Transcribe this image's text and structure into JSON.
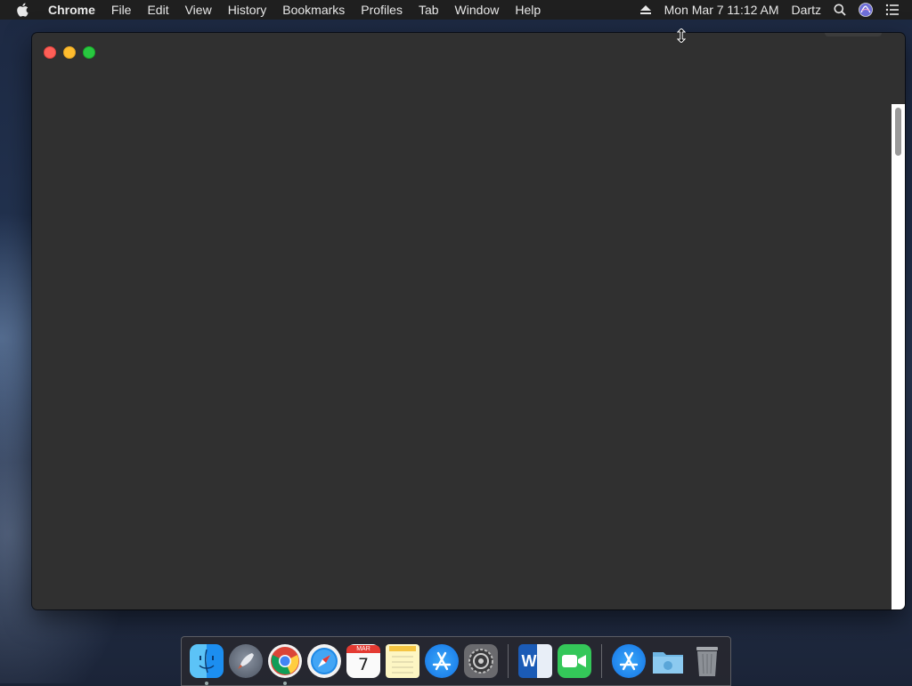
{
  "menubar": {
    "app_name": "Chrome",
    "items": [
      "File",
      "Edit",
      "View",
      "History",
      "Bookmarks",
      "Profiles",
      "Tab",
      "Window",
      "Help"
    ],
    "clock": "Mon Mar 7  11:12 AM",
    "user": "Dartz"
  },
  "window": {
    "background": "#303030"
  },
  "dock": {
    "apps": [
      "Finder",
      "Launchpad",
      "Google Chrome",
      "Safari",
      "Calendar",
      "Notes",
      "App Store",
      "System Preferences",
      "Microsoft Word",
      "FaceTime",
      "App Store",
      "Downloads",
      "Trash"
    ],
    "calendar_month": "MAR",
    "calendar_day": "7",
    "word_letter": "W"
  }
}
